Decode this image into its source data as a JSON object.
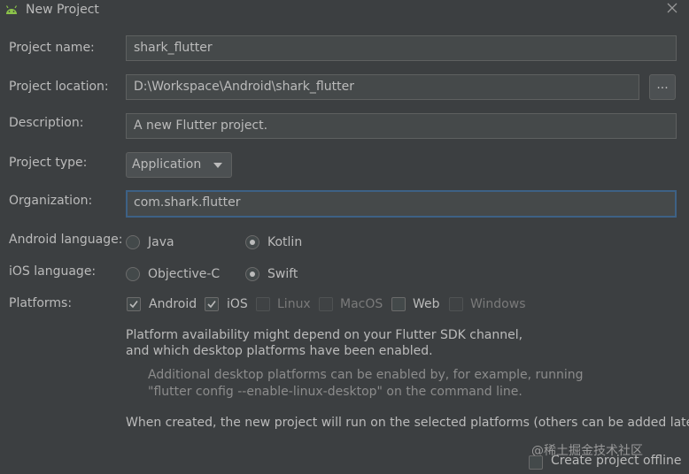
{
  "window": {
    "title": "New Project",
    "icon": "android-icon",
    "close_icon": "close-icon"
  },
  "form": {
    "project_name": {
      "label": "Project name:",
      "value": "shark_flutter"
    },
    "project_location": {
      "label": "Project location:",
      "value": "D:\\Workspace\\Android\\shark_flutter",
      "browse_label": "..."
    },
    "description": {
      "label": "Description:",
      "value": "A new Flutter project."
    },
    "project_type": {
      "label": "Project type:",
      "selected": "Application"
    },
    "organization": {
      "label": "Organization:",
      "value": "com.shark.flutter"
    },
    "android_language": {
      "label": "Android language:",
      "options": [
        "Java",
        "Kotlin"
      ],
      "selected": "Kotlin"
    },
    "ios_language": {
      "label": "iOS language:",
      "options": [
        "Objective-C",
        "Swift"
      ],
      "selected": "Swift"
    },
    "platforms": {
      "label": "Platforms:",
      "items": [
        {
          "label": "Android",
          "checked": true,
          "enabled": true
        },
        {
          "label": "iOS",
          "checked": true,
          "enabled": true
        },
        {
          "label": "Linux",
          "checked": false,
          "enabled": false
        },
        {
          "label": "MacOS",
          "checked": false,
          "enabled": false
        },
        {
          "label": "Web",
          "checked": false,
          "enabled": true
        },
        {
          "label": "Windows",
          "checked": false,
          "enabled": false
        }
      ]
    }
  },
  "notes": {
    "availability_line1": "Platform availability might depend on your Flutter SDK channel,",
    "availability_line2": "and which desktop platforms have been enabled.",
    "additional_line1": "Additional desktop platforms can be enabled by, for example, running",
    "additional_line2": "\"flutter config --enable-linux-desktop\" on the command line.",
    "created": "When created, the new project will run on the selected platforms (others can be added later)."
  },
  "watermark": "@稀土掘金技术社区",
  "create_offline": {
    "label": "Create project offline",
    "checked": false
  }
}
